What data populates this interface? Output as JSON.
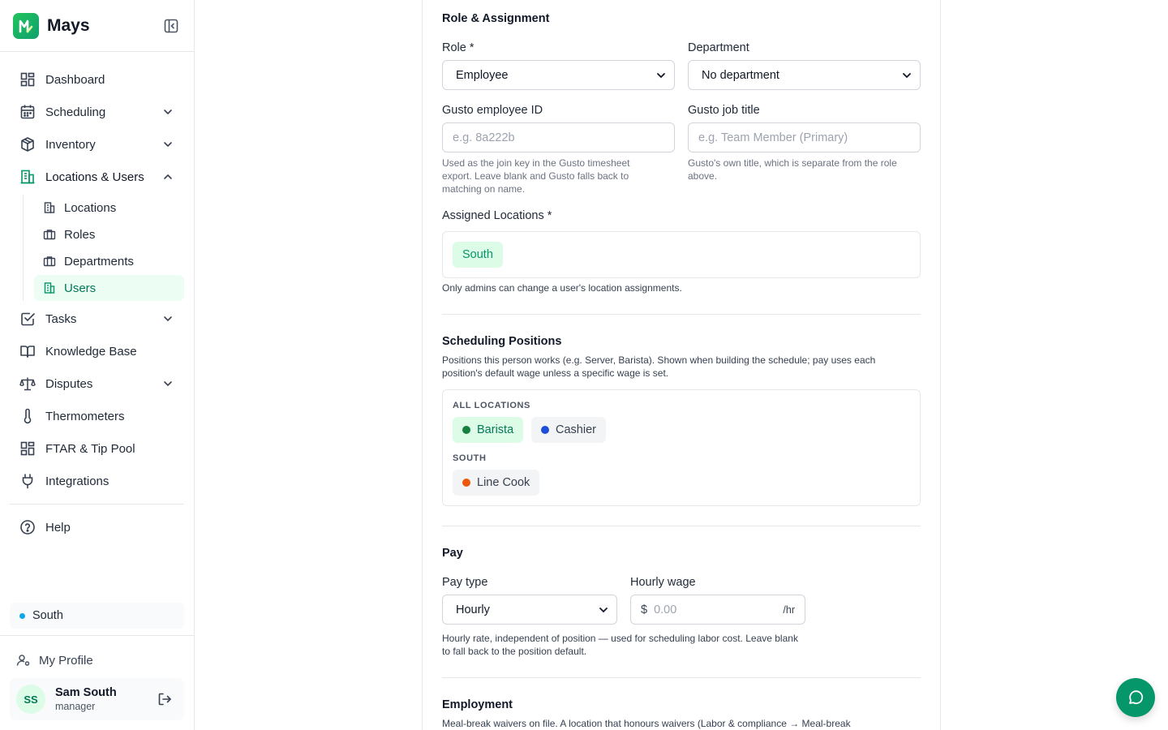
{
  "app": {
    "name": "Mays"
  },
  "sidebar": {
    "items": [
      {
        "label": "Dashboard"
      },
      {
        "label": "Scheduling"
      },
      {
        "label": "Inventory"
      },
      {
        "label": "Locations & Users"
      },
      {
        "label": "Tasks"
      },
      {
        "label": "Knowledge Base"
      },
      {
        "label": "Disputes"
      },
      {
        "label": "Thermometers"
      },
      {
        "label": "FTAR & Tip Pool"
      },
      {
        "label": "Integrations"
      },
      {
        "label": "Help"
      }
    ],
    "sub_items": [
      {
        "label": "Locations"
      },
      {
        "label": "Roles"
      },
      {
        "label": "Departments"
      },
      {
        "label": "Users"
      }
    ],
    "current_location": "South",
    "my_profile": "My Profile",
    "user": {
      "initials": "SS",
      "name": "Sam South",
      "role": "manager"
    }
  },
  "form": {
    "role_section": {
      "title": "Role & Assignment",
      "role_label": "Role *",
      "role_value": "Employee",
      "department_label": "Department",
      "department_value": "No department",
      "gusto_id_label": "Gusto employee ID",
      "gusto_id_placeholder": "e.g. 8a222b",
      "gusto_id_help": "Used as the join key in the Gusto timesheet export. Leave blank and Gusto falls back to matching on name.",
      "gusto_title_label": "Gusto job title",
      "gusto_title_placeholder": "e.g. Team Member (Primary)",
      "gusto_title_help": "Gusto's own title, which is separate from the role above.",
      "locations_label": "Assigned Locations *",
      "locations": [
        "South"
      ],
      "locations_help": "Only admins can change a user's location assignments."
    },
    "positions_section": {
      "title": "Scheduling Positions",
      "description": "Positions this person works (e.g. Server, Barista). Shown when building the schedule; pay uses each position's default wage unless a specific wage is set.",
      "groups": [
        {
          "label": "ALL LOCATIONS",
          "positions": [
            {
              "name": "Barista",
              "color": "#15803d",
              "selected": true
            },
            {
              "name": "Cashier",
              "color": "#1d4ed8",
              "selected": false
            }
          ]
        },
        {
          "label": "SOUTH",
          "positions": [
            {
              "name": "Line Cook",
              "color": "#ea580c",
              "selected": false
            }
          ]
        }
      ]
    },
    "pay_section": {
      "title": "Pay",
      "pay_type_label": "Pay type",
      "pay_type_value": "Hourly",
      "wage_label": "Hourly wage",
      "wage_currency": "$",
      "wage_placeholder": "0.00",
      "wage_unit": "/hr",
      "help": "Hourly rate, independent of position — used for scheduling labor cost. Leave blank to fall back to the position default."
    },
    "employment_section": {
      "title": "Employment",
      "description": "Meal-break waivers on file. A location that honours waivers (Labor & compliance → Meal-break"
    }
  },
  "colors": {
    "accent": "#059669",
    "accent_bg": "#ecfdf3"
  }
}
